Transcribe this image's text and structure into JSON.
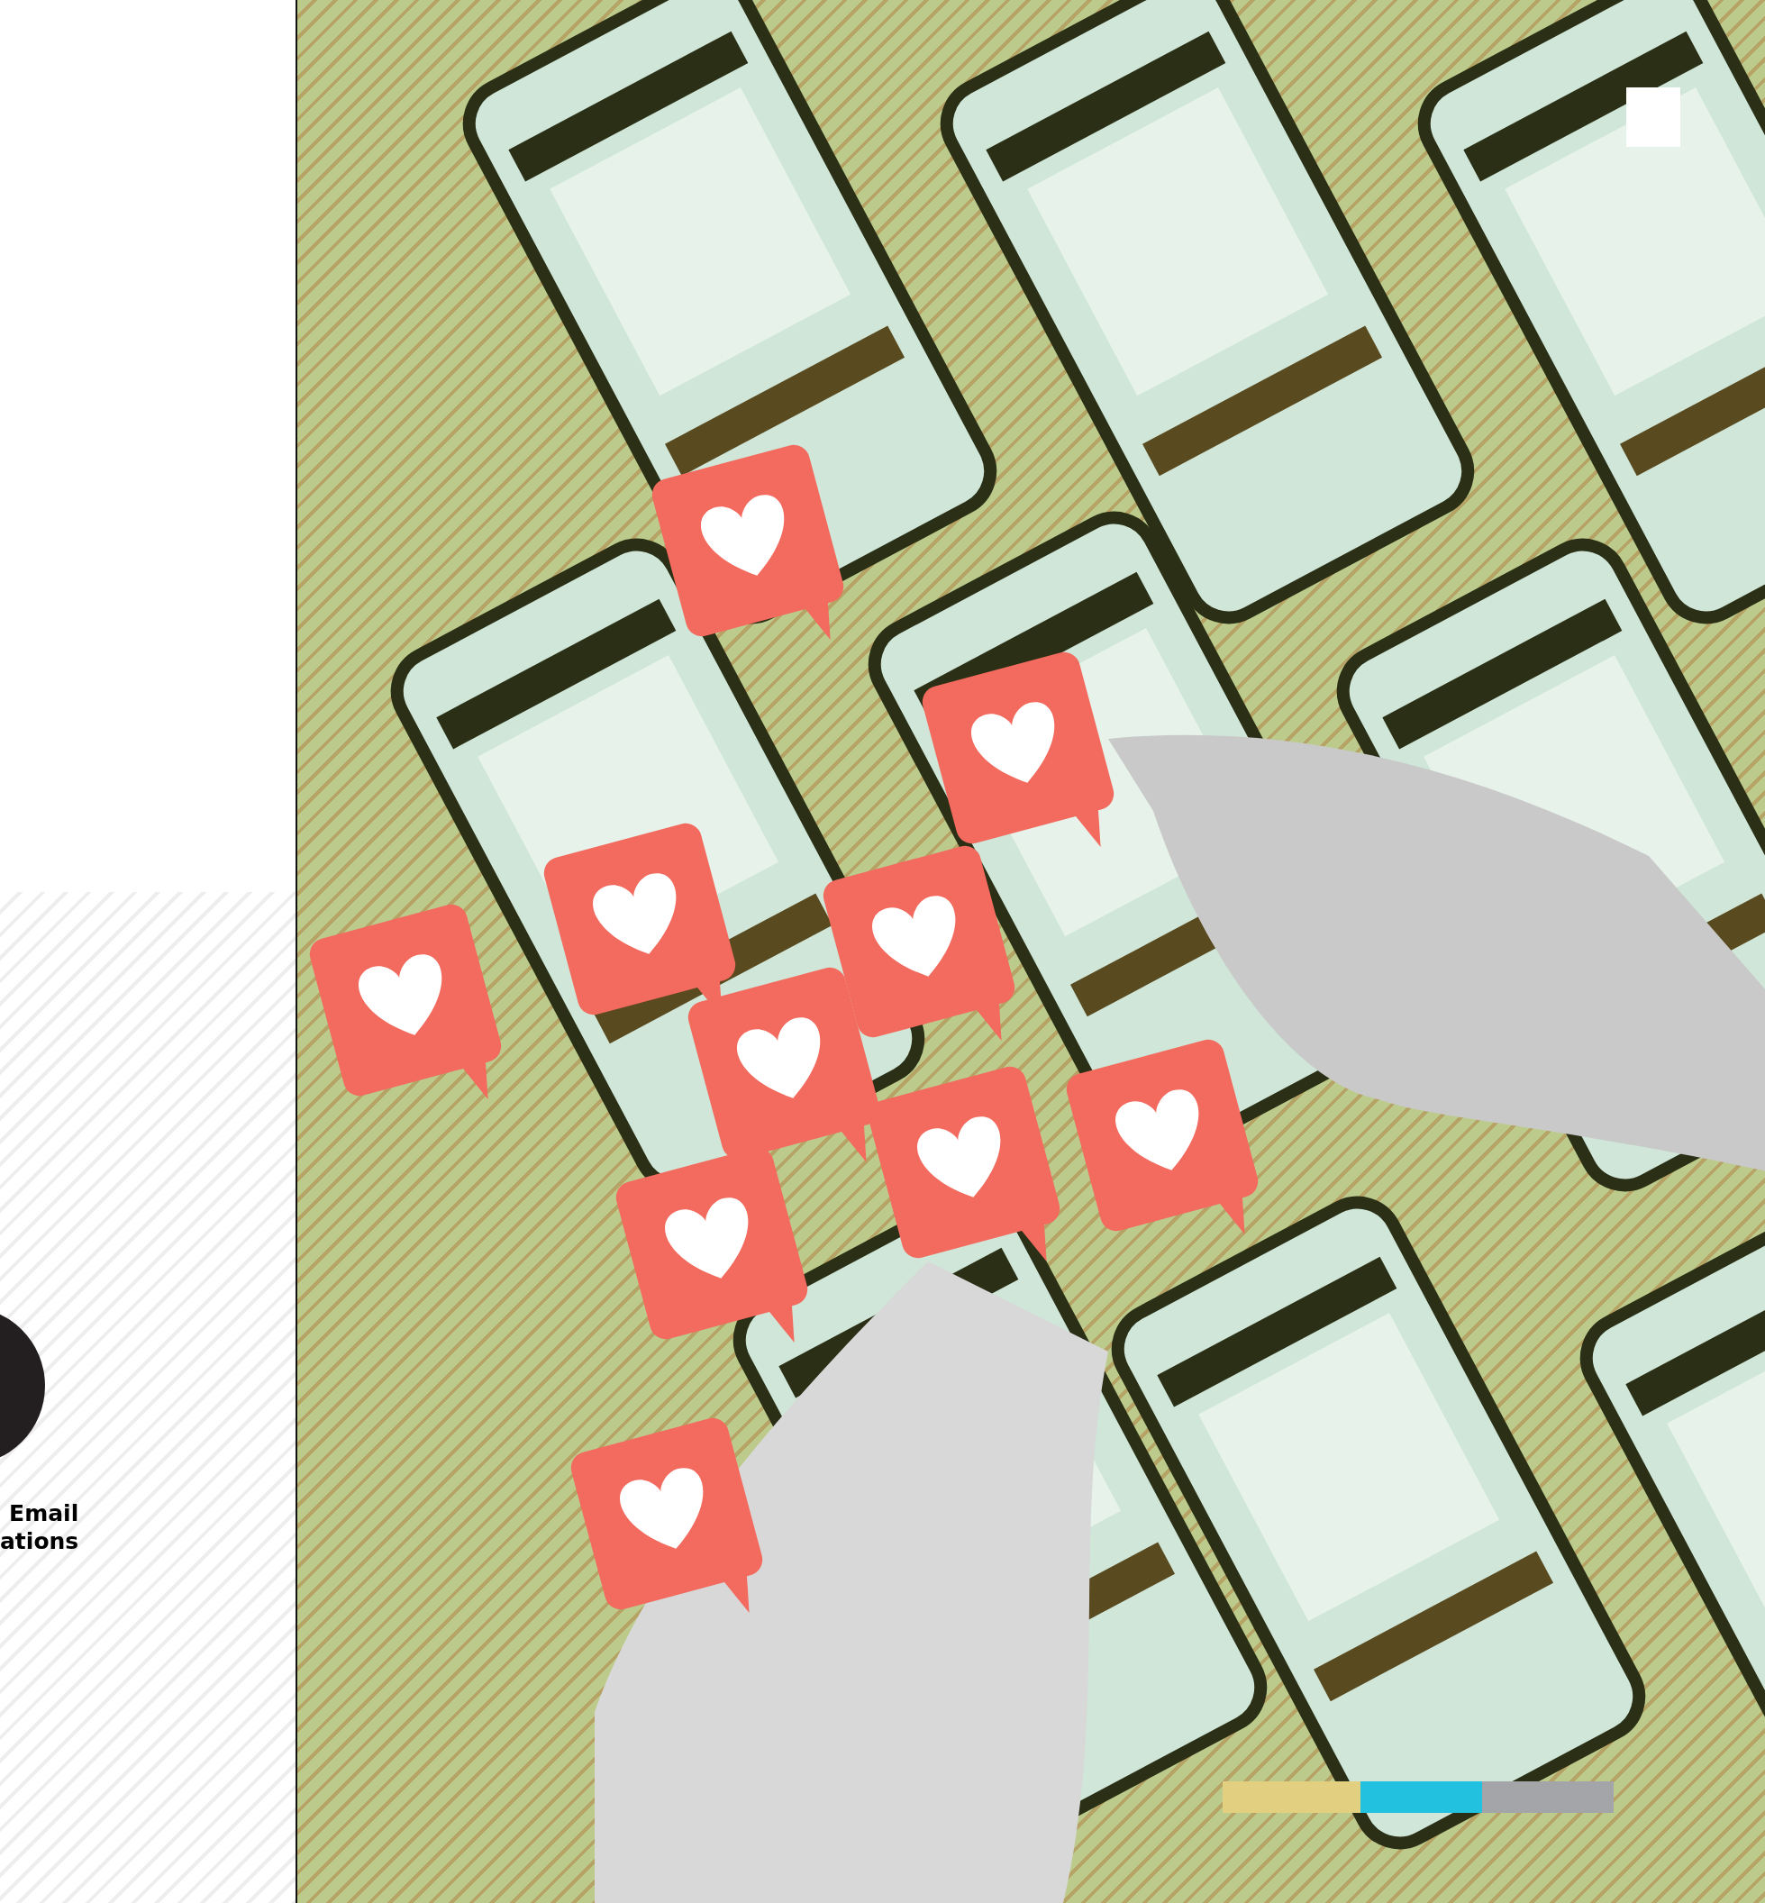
{
  "feature": {
    "label_lines": [
      "Email",
      "ations"
    ]
  },
  "color_bar": [
    {
      "color": "#e2cf80"
    },
    {
      "color": "#22c1df"
    },
    {
      "color": "#a3a5a8"
    }
  ]
}
